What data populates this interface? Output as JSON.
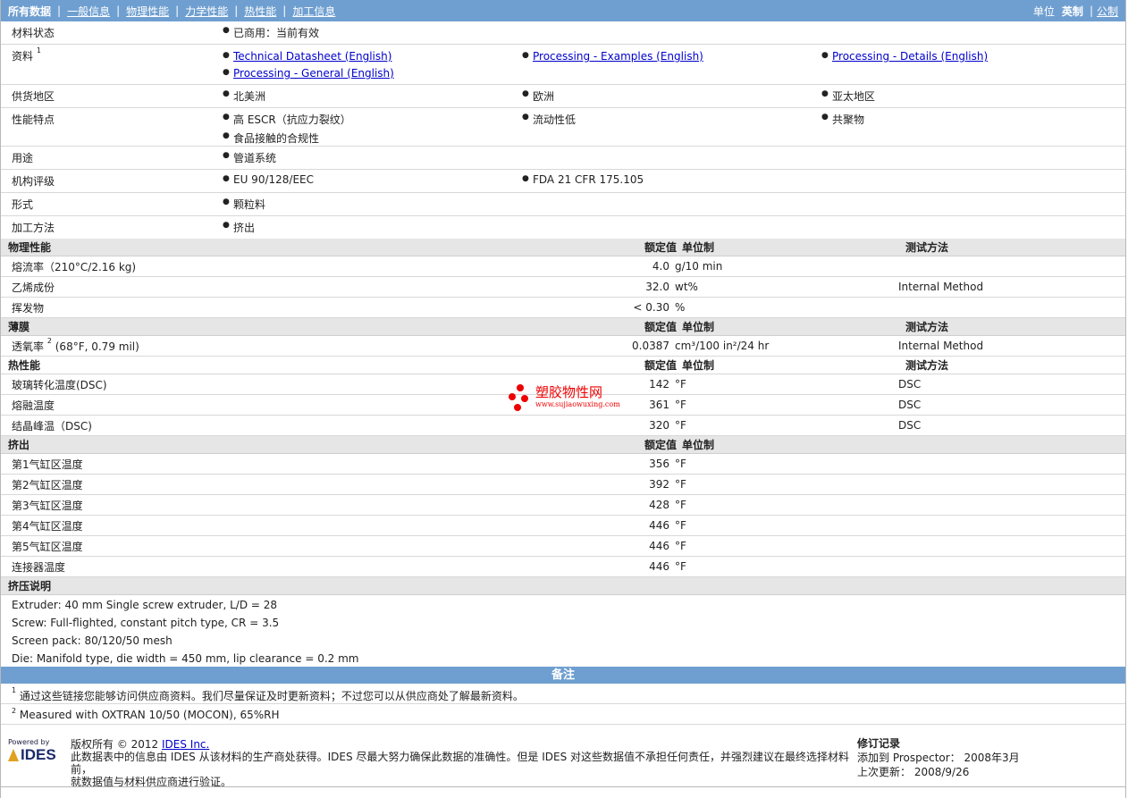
{
  "nav": {
    "tabs": [
      "所有数据",
      "一般信息",
      "物理性能",
      "力学性能",
      "热性能",
      "加工信息"
    ],
    "unit_label": "单位",
    "unit_english": "英制",
    "unit_metric": "公制"
  },
  "info": {
    "status_label": "材料状态",
    "status": "已商用：当前有效",
    "docs_label": "资料",
    "docs_sup": "1",
    "docs": [
      "Technical Datasheet (English)",
      "Processing - Examples (English)",
      "Processing - Details (English)",
      "Processing - General (English)"
    ],
    "region_label": "供货地区",
    "regions": [
      "北美洲",
      "欧洲",
      "亚太地区"
    ],
    "features_label": "性能特点",
    "features": [
      "高 ESCR（抗应力裂纹）",
      "流动性低",
      "共聚物",
      "食品接触的合规性"
    ],
    "uses_label": "用途",
    "uses": [
      "管道系统"
    ],
    "agency_label": "机构评级",
    "agency": [
      "EU 90/128/EEC",
      "FDA 21 CFR 175.105"
    ],
    "form_label": "形式",
    "form": [
      "颗粒料"
    ],
    "method_label": "加工方法",
    "method": [
      "挤出"
    ]
  },
  "cols": {
    "value": "额定值",
    "unit": "单位制",
    "test": "测试方法"
  },
  "physical": {
    "title": "物理性能",
    "rows": [
      {
        "name": "熔流率（210°C/2.16 kg)",
        "value": "4.0",
        "unit": "g/10 min",
        "test": ""
      },
      {
        "name": "乙烯成份",
        "value": "32.0",
        "unit": "wt%",
        "test": "Internal Method"
      },
      {
        "name": "挥发物",
        "value": "< 0.30",
        "unit": "%",
        "test": ""
      }
    ]
  },
  "film": {
    "title": "薄膜",
    "rows": [
      {
        "name": "透氧率",
        "sup": "2",
        "cond": " (68°F, 0.79 mil)",
        "value": "0.0387",
        "unit": "cm³/100 in²/24 hr",
        "test": "Internal Method"
      }
    ]
  },
  "thermal": {
    "title": "热性能",
    "rows": [
      {
        "name": "玻璃转化温度(DSC)",
        "value": "142",
        "unit": "°F",
        "test": "DSC"
      },
      {
        "name": "熔融温度",
        "value": "361",
        "unit": "°F",
        "test": "DSC"
      },
      {
        "name": "结晶峰温（DSC)",
        "value": "320",
        "unit": "°F",
        "test": "DSC"
      }
    ]
  },
  "extrusion": {
    "title": "挤出",
    "rows": [
      {
        "name": "第1气缸区温度",
        "value": "356",
        "unit": "°F"
      },
      {
        "name": "第2气缸区温度",
        "value": "392",
        "unit": "°F"
      },
      {
        "name": "第3气缸区温度",
        "value": "428",
        "unit": "°F"
      },
      {
        "name": "第4气缸区温度",
        "value": "446",
        "unit": "°F"
      },
      {
        "name": "第5气缸区温度",
        "value": "446",
        "unit": "°F"
      },
      {
        "name": "连接器温度",
        "value": "446",
        "unit": "°F"
      }
    ]
  },
  "notes": {
    "title": "挤压说明",
    "lines": [
      "Extruder: 40 mm Single screw extruder, L/D = 28",
      "Screw: Full-flighted, constant pitch type, CR = 3.5",
      "Screen pack: 80/120/50 mesh",
      "Die: Manifold type, die width = 450 mm, lip clearance = 0.2 mm"
    ]
  },
  "remarks": {
    "title": "备注",
    "items": [
      {
        "num": "1",
        "text": "通过这些链接您能够访问供应商资料。我们尽量保证及时更新资料；不过您可以从供应商处了解最新资料。"
      },
      {
        "num": "2",
        "text": "Measured with OXTRAN 10/50 (MOCON), 65%RH"
      }
    ]
  },
  "footer": {
    "powered": "Powered by",
    "logo": "IDES",
    "copyright_prefix": "版权所有 © 2012 ",
    "copyright_link": "IDES Inc.",
    "disclaimer1": "此数据表中的信息由 IDES 从该材料的生产商处获得。IDES 尽最大努力确保此数据的准确性。但是 IDES 对这些数据值不承担任何责任，并强烈建议在最终选择材料前，",
    "disclaimer2": "就数据值与材料供应商进行验证。",
    "rev_title": "修订记录",
    "rev_added": "添加到 Prospector： 2008年3月",
    "rev_updated": "上次更新： 2008/9/26"
  },
  "watermark": {
    "cn": "塑胶物性网",
    "url": "www.sujiaowuxing.com"
  }
}
